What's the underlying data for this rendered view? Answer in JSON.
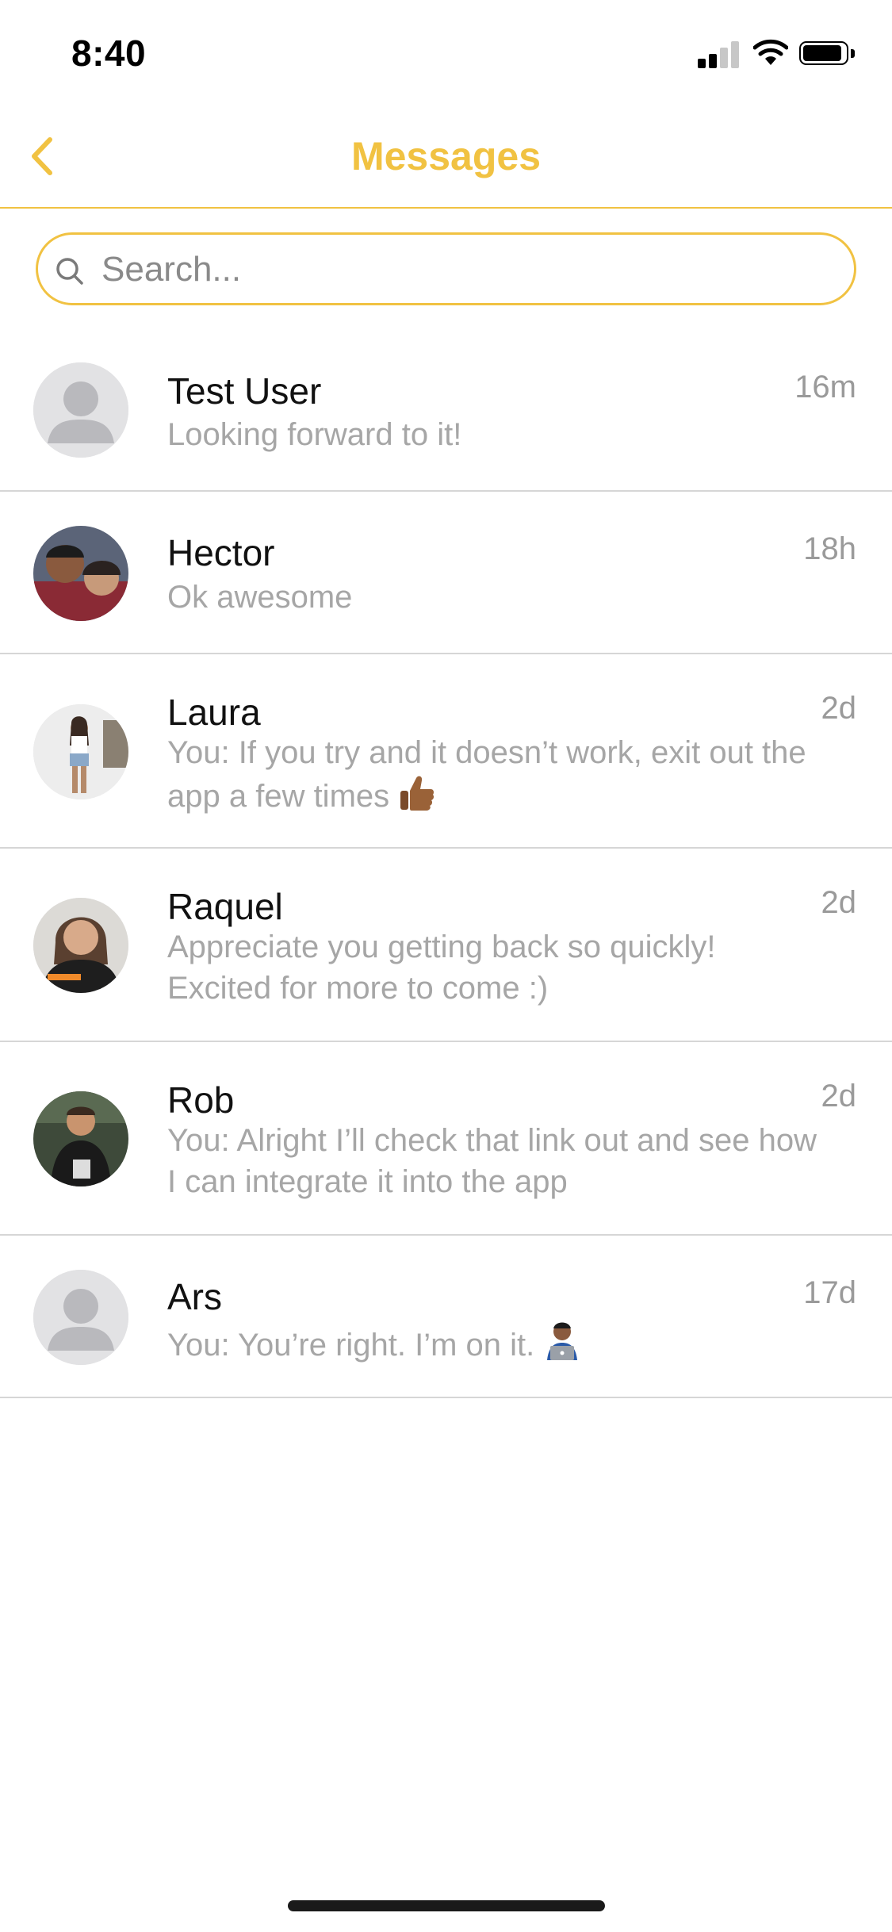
{
  "status_bar": {
    "time": "8:40"
  },
  "header": {
    "title": "Messages"
  },
  "search": {
    "placeholder": "Search...",
    "value": ""
  },
  "conversations": [
    {
      "name": "Test User",
      "time": "16m",
      "preview": "Looking forward to it!",
      "avatar": "default-avatar"
    },
    {
      "name": "Hector",
      "time": "18h",
      "preview": "Ok awesome",
      "avatar": "photo-avatar"
    },
    {
      "name": "Laura",
      "time": "2d",
      "preview": "You: If you try and it doesn’t work, exit out the app a few times",
      "emoji": "thumbs-up-icon",
      "avatar": "photo-avatar"
    },
    {
      "name": "Raquel",
      "time": "2d",
      "preview": "Appreciate you getting back so quickly! Excited for more to come :)",
      "avatar": "photo-avatar"
    },
    {
      "name": "Rob",
      "time": "2d",
      "preview": "You: Alright I’ll check that link out and see how I can integrate it into the app",
      "avatar": "photo-avatar"
    },
    {
      "name": "Ars",
      "time": "17d",
      "preview": "You: You’re right. I’m on it.",
      "emoji": "technologist-icon",
      "avatar": "default-avatar"
    }
  ],
  "colors": {
    "accent": "#f1c242",
    "divider": "#d6d6d6",
    "preview_text": "#a6a6a6"
  }
}
